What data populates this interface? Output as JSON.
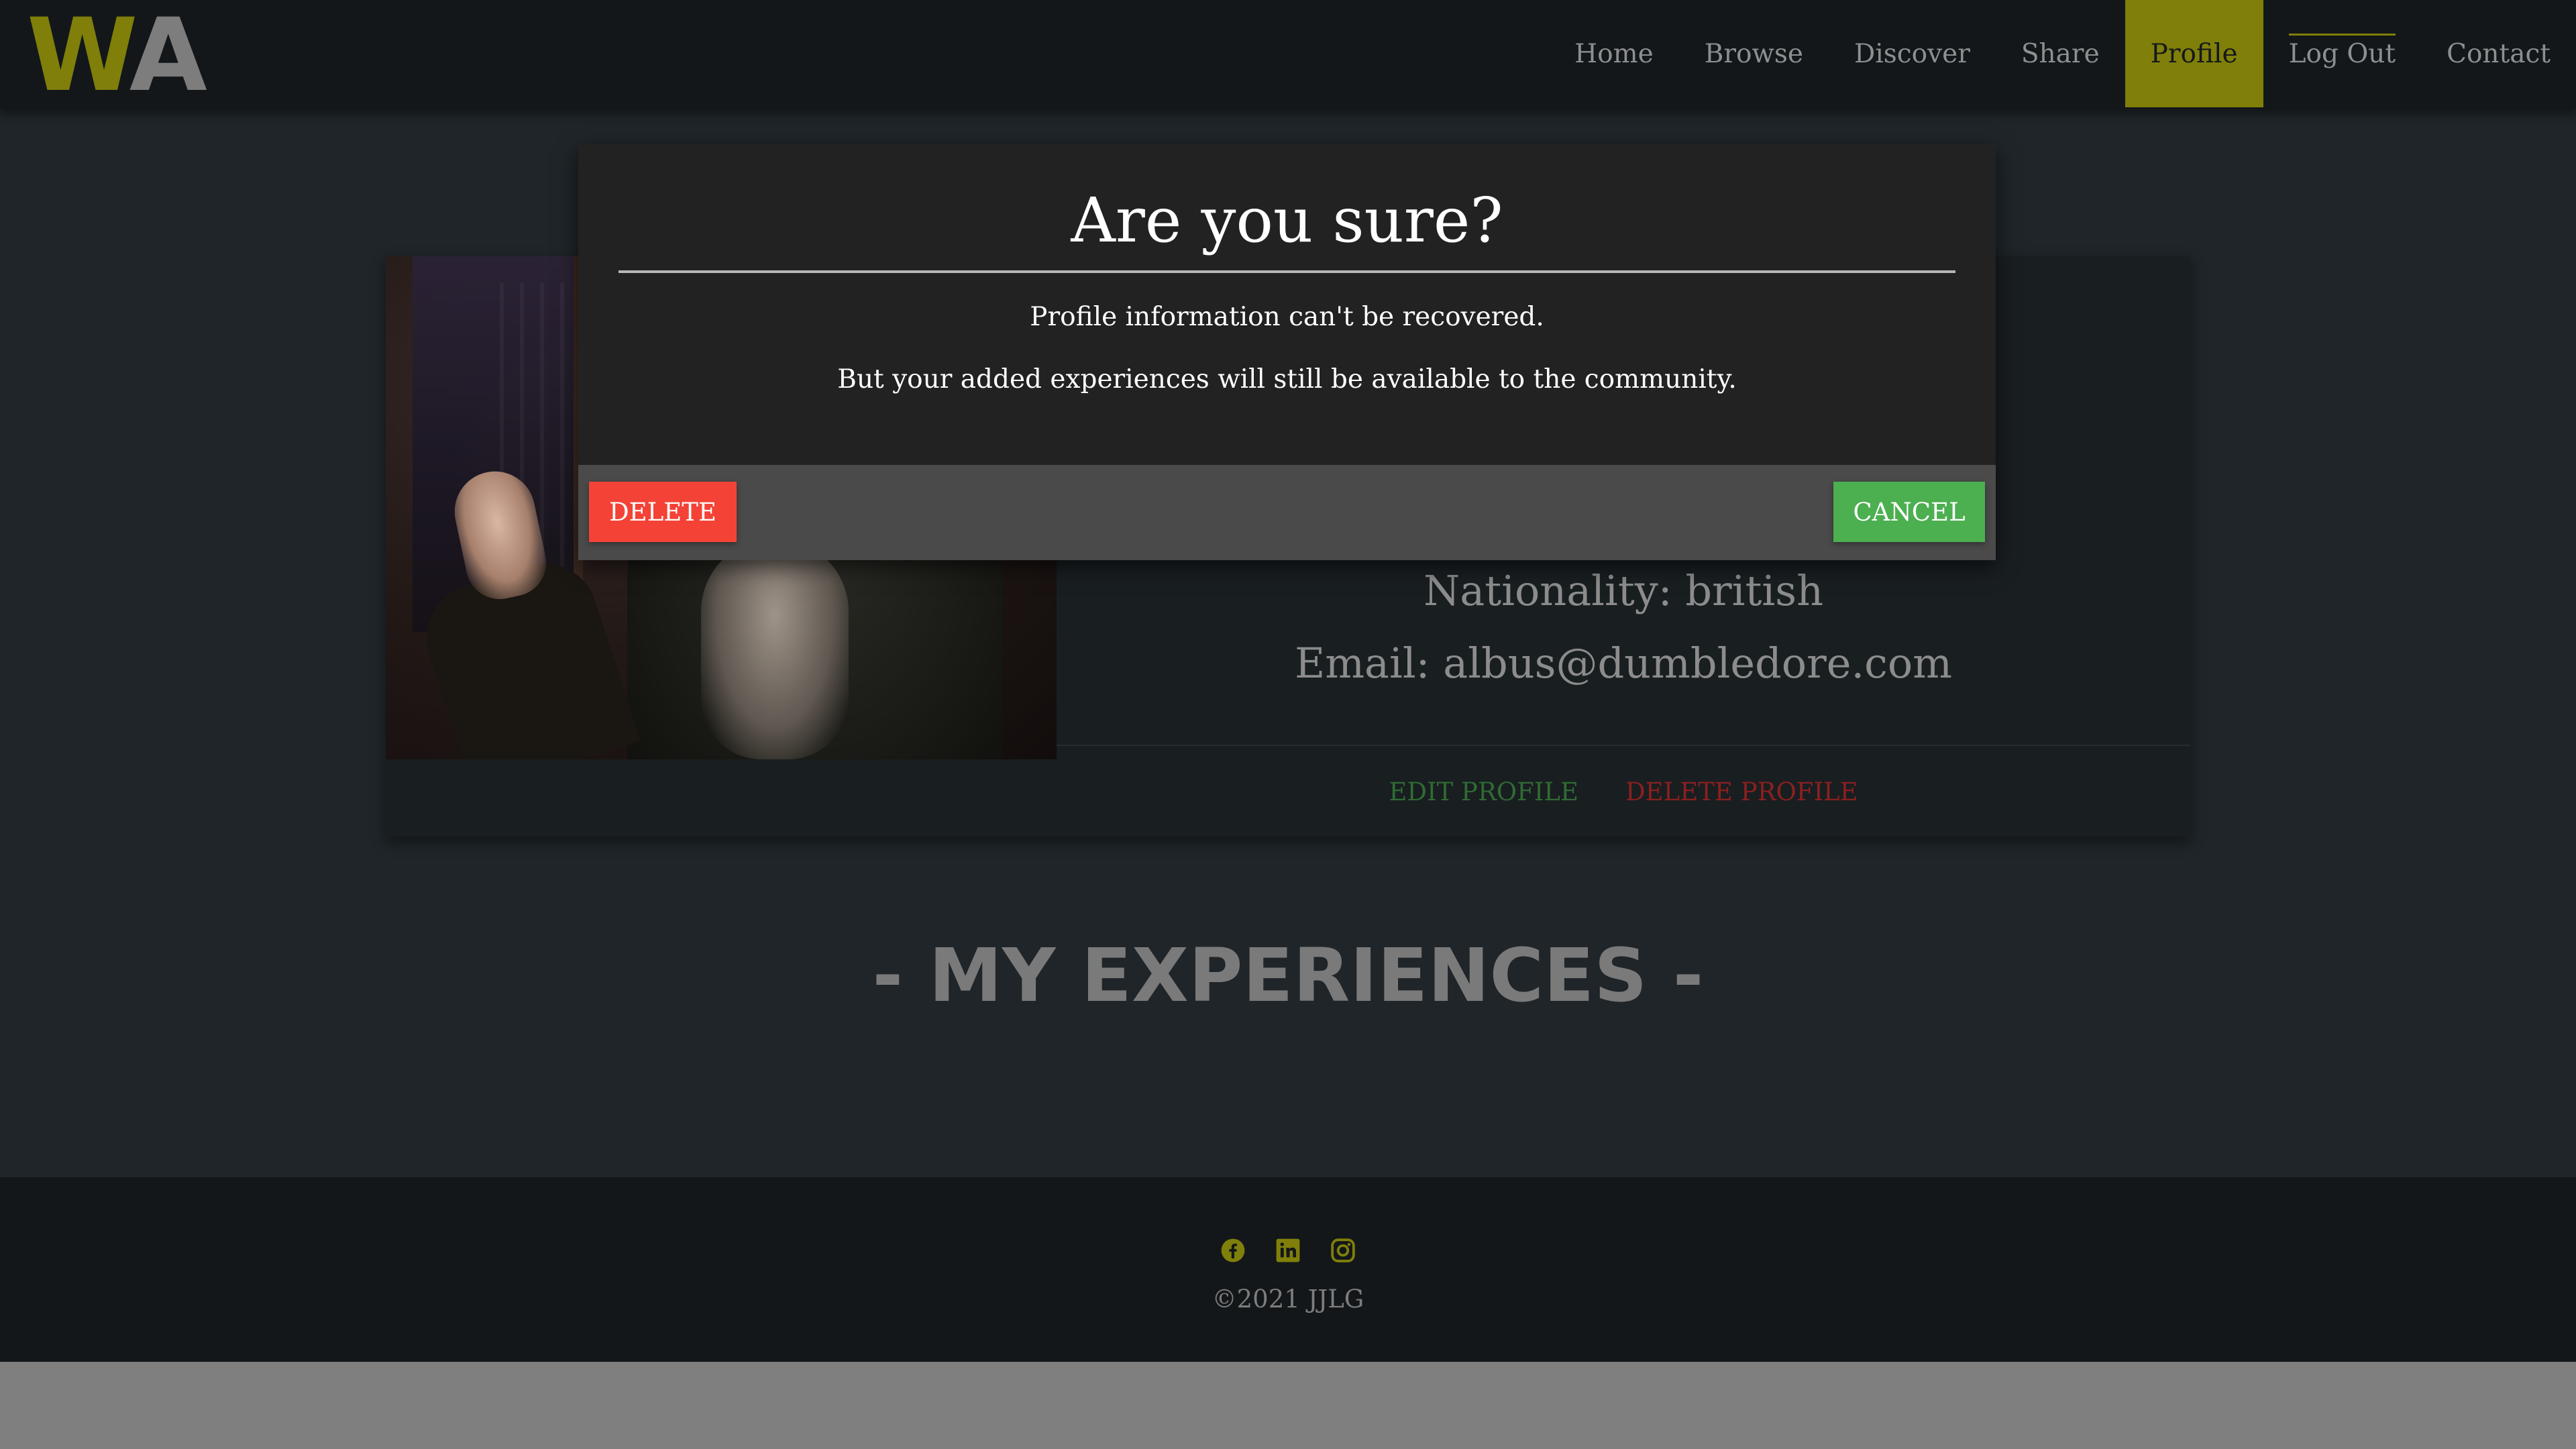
{
  "navbar": {
    "logo": {
      "w": "W",
      "a": "A"
    },
    "items": [
      {
        "label": "Home"
      },
      {
        "label": "Browse"
      },
      {
        "label": "Discover"
      },
      {
        "label": "Share"
      },
      {
        "label": "Profile",
        "active": true
      },
      {
        "label": "Log Out"
      },
      {
        "label": "Contact"
      }
    ]
  },
  "profile": {
    "nationality": "Nationality: british",
    "email": "Email: albus@dumbledore.com",
    "edit_label": "EDIT PROFILE",
    "delete_label": "DELETE PROFILE"
  },
  "section": {
    "title": "- MY EXPERIENCES -"
  },
  "modal": {
    "title": "Are you sure?",
    "line1": "Profile information can't be recovered.",
    "line2": "But your added experiences will still be available to the community.",
    "delete_label": "DELETE",
    "cancel_label": "CANCEL"
  },
  "footer": {
    "socials": [
      "facebook-icon",
      "linkedin-icon",
      "instagram-icon"
    ],
    "copyright": "©2021 JJLG"
  },
  "colors": {
    "accent": "#7f7f0a",
    "danger": "#f44336",
    "success": "#4caf50",
    "background": "#1f2529",
    "navbar": "#13171a"
  }
}
